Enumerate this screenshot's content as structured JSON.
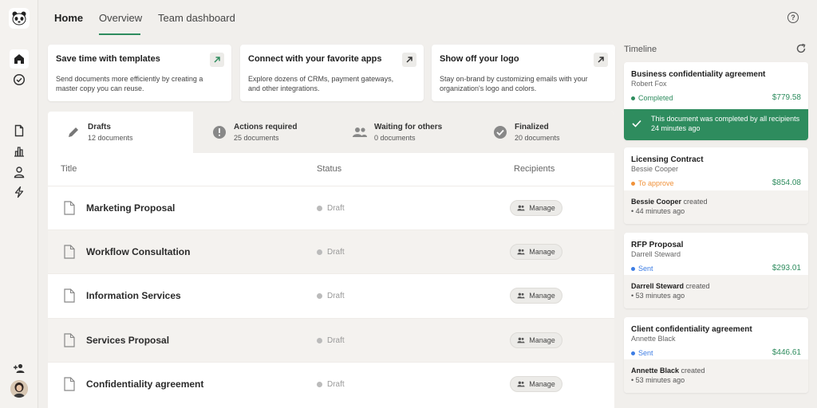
{
  "nav": {
    "tabs": [
      {
        "label": "Home"
      },
      {
        "label": "Overview"
      },
      {
        "label": "Team dashboard"
      }
    ],
    "help_icon": "question-circle-icon"
  },
  "sidebar": {
    "logo": "panda-logo",
    "items": [
      {
        "icon": "home-icon"
      },
      {
        "icon": "check-circle-icon"
      },
      {
        "icon": "document-icon"
      },
      {
        "icon": "bar-chart-icon"
      },
      {
        "icon": "user-icon"
      },
      {
        "icon": "lightning-icon"
      },
      {
        "icon": "add-user-icon"
      }
    ]
  },
  "promos": [
    {
      "title": "Save time with templates",
      "desc": "Send documents more efficiently by creating a master copy you can reuse.",
      "accent": "#2e8c5e"
    },
    {
      "title": "Connect with your favorite apps",
      "desc": "Explore dozens of CRMs, payment gateways, and other integrations.",
      "accent": "#333333"
    },
    {
      "title": "Show off your logo",
      "desc": "Stay on-brand by customizing emails with your organization's logo and colors.",
      "accent": "#333333"
    }
  ],
  "filters": [
    {
      "title": "Drafts",
      "count": "12 documents"
    },
    {
      "title": "Actions required",
      "count": "25 documents"
    },
    {
      "title": "Waiting for others",
      "count": "0 documents"
    },
    {
      "title": "Finalized",
      "count": "20 documents"
    }
  ],
  "table": {
    "headers": {
      "title": "Title",
      "status": "Status",
      "recipients": "Recipients"
    },
    "rows": [
      {
        "title": "Marketing Proposal",
        "status": "Draft",
        "action": "Manage"
      },
      {
        "title": "Workflow Consultation",
        "status": "Draft",
        "action": "Manage"
      },
      {
        "title": "Information Services",
        "status": "Draft",
        "action": "Manage"
      },
      {
        "title": "Services Proposal",
        "status": "Draft",
        "action": "Manage"
      },
      {
        "title": "Confidentiality agreement",
        "status": "Draft",
        "action": "Manage"
      }
    ]
  },
  "timeline": {
    "title": "Timeline",
    "cards": [
      {
        "title": "Business confidentiality agreement",
        "person": "Robert Fox",
        "status": "Completed",
        "status_color": "#2e8c5e",
        "amount": "$779.58",
        "message": "This document was completed by all recipients 24 minutes ago"
      },
      {
        "title": "Licensing Contract",
        "person": "Bessie Cooper",
        "status": "To approve",
        "status_color": "#f0923a",
        "amount": "$854.08",
        "actor": "Bessie Cooper",
        "action": "created",
        "time": "• 44 minutes ago"
      },
      {
        "title": "RFP Proposal",
        "person": "Darrell Steward",
        "status": "Sent",
        "status_color": "#3d7de4",
        "amount": "$293.01",
        "actor": "Darrell Steward",
        "action": "created",
        "time": "• 53 minutes ago"
      },
      {
        "title": "Client confidentiality agreement",
        "person": "Annette Black",
        "status": "Sent",
        "status_color": "#3d7de4",
        "amount": "$446.61",
        "actor": "Annette Black",
        "action": "created",
        "time": "• 53 minutes ago"
      }
    ]
  }
}
